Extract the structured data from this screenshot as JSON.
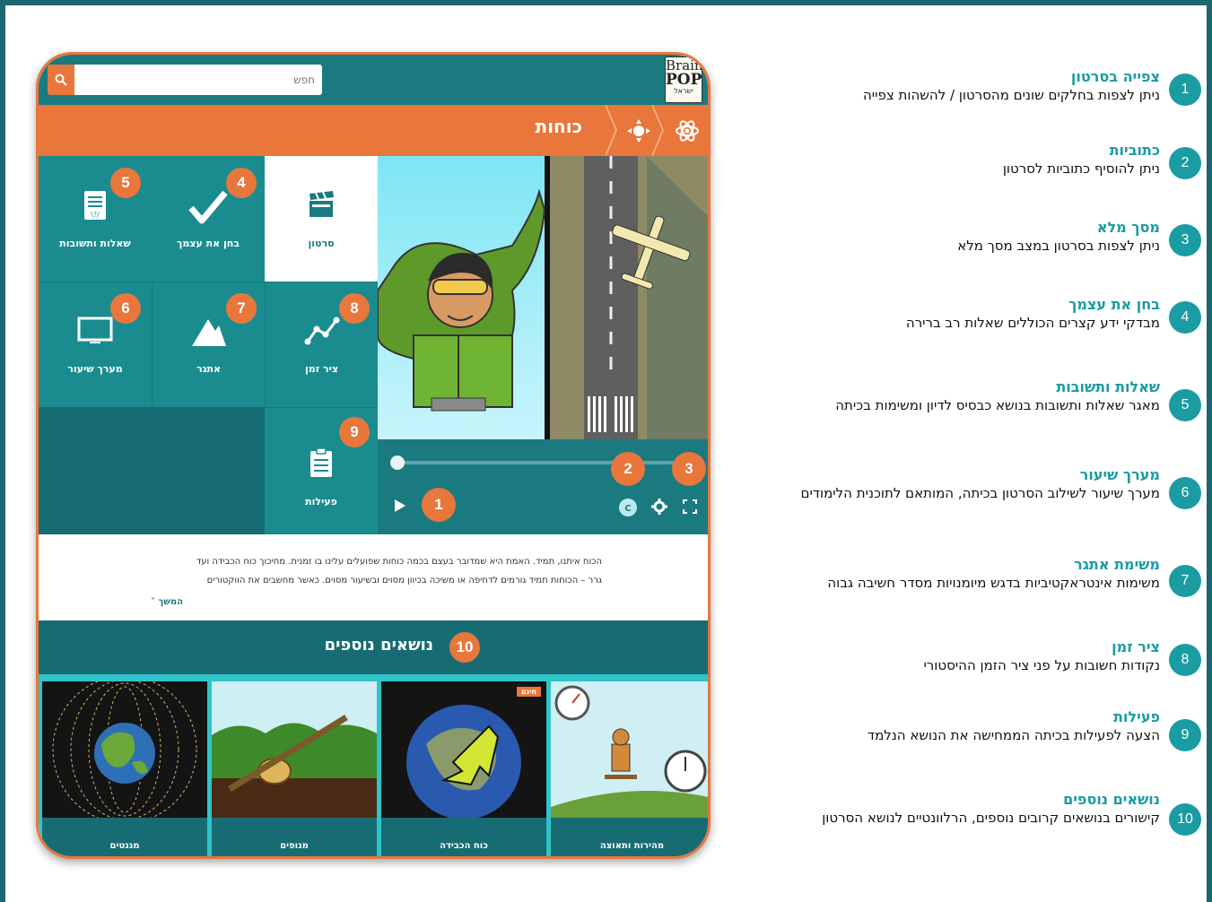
{
  "search": {
    "placeholder": "חפש"
  },
  "logo": {
    "line1": "Brain",
    "line2": "POP",
    "line3": "ישראל"
  },
  "topic": {
    "title": "כוחות"
  },
  "tiles": {
    "movie": "סרטון",
    "quiz": "בחן את עצמך",
    "qa": "שאלות ותשובות",
    "timeline": "ציר זמן",
    "challenge": "אתגר",
    "lesson": "מערך שיעור",
    "activities": "פעילות"
  },
  "badges": {
    "b1": "1",
    "b2": "2",
    "b3": "3",
    "b4": "4",
    "b5": "5",
    "b6": "6",
    "b7": "7",
    "b8": "8",
    "b9": "9",
    "b10": "10"
  },
  "description": {
    "line1": "הכוח איתנו, תמיד. האמת היא שמדובר בעצם בכמה כוחות שפועלים עלינו בו זמנית. מחיכוך כוח הכבידה ועד",
    "line2": "גרר – הכוחות תמיד גורמים לדחיפה או משיכה בכיוון מסוים ובשיעור מסוים. כאשר מחשבים את הווקטורים",
    "more": "המשך ˅"
  },
  "related": {
    "title": "נושאים נוספים",
    "free": "חינם",
    "cards": [
      "מהירות ותאוצה",
      "כוח הכבידה",
      "מנופים",
      "מגנטים"
    ]
  },
  "legend": [
    {
      "num": "1",
      "title": "צפייה בסרטון",
      "desc": "ניתן לצפות בחלקים שונים מהסרטון / להשהות צפייה"
    },
    {
      "num": "2",
      "title": "כתוביות",
      "desc": "ניתן להוסיף כתוביות לסרטון"
    },
    {
      "num": "3",
      "title": "מסך מלא",
      "desc": "ניתן לצפות בסרטון במצב מסך מלא"
    },
    {
      "num": "4",
      "title": "בחן את עצמך",
      "desc": "מבדקי ידע קצרים הכוללים שאלות רב ברירה"
    },
    {
      "num": "5",
      "title": "שאלות ותשובות",
      "desc": "מאגר שאלות ותשובות בנושא כבסיס לדיון ומשימות בכיתה"
    },
    {
      "num": "6",
      "title": "מערך שיעור",
      "desc": "מערך שיעור לשילוב הסרטון בכיתה, המותאם לתוכנית הלימודים"
    },
    {
      "num": "7",
      "title": "משימת אתגר",
      "desc": "משימות אינטראקטיביות בדגש מיומנויות מסדר חשיבה גבוה"
    },
    {
      "num": "8",
      "title": "ציר זמן",
      "desc": "נקודות חשובות על פני ציר הזמן ההיסטורי"
    },
    {
      "num": "9",
      "title": "פעילות",
      "desc": "הצעה לפעילות בכיתה הממחישה את הנושא הנלמד"
    },
    {
      "num": "10",
      "title": "נושאים נוספים",
      "desc": "קישורים בנושאים קרובים נוספים, הרלוונטיים לנושא הסרטון"
    }
  ],
  "colors": {
    "teal": "#1a7a80",
    "tile": "#1a8c8f",
    "orange": "#e9763b",
    "accent": "#1a9ca2"
  }
}
